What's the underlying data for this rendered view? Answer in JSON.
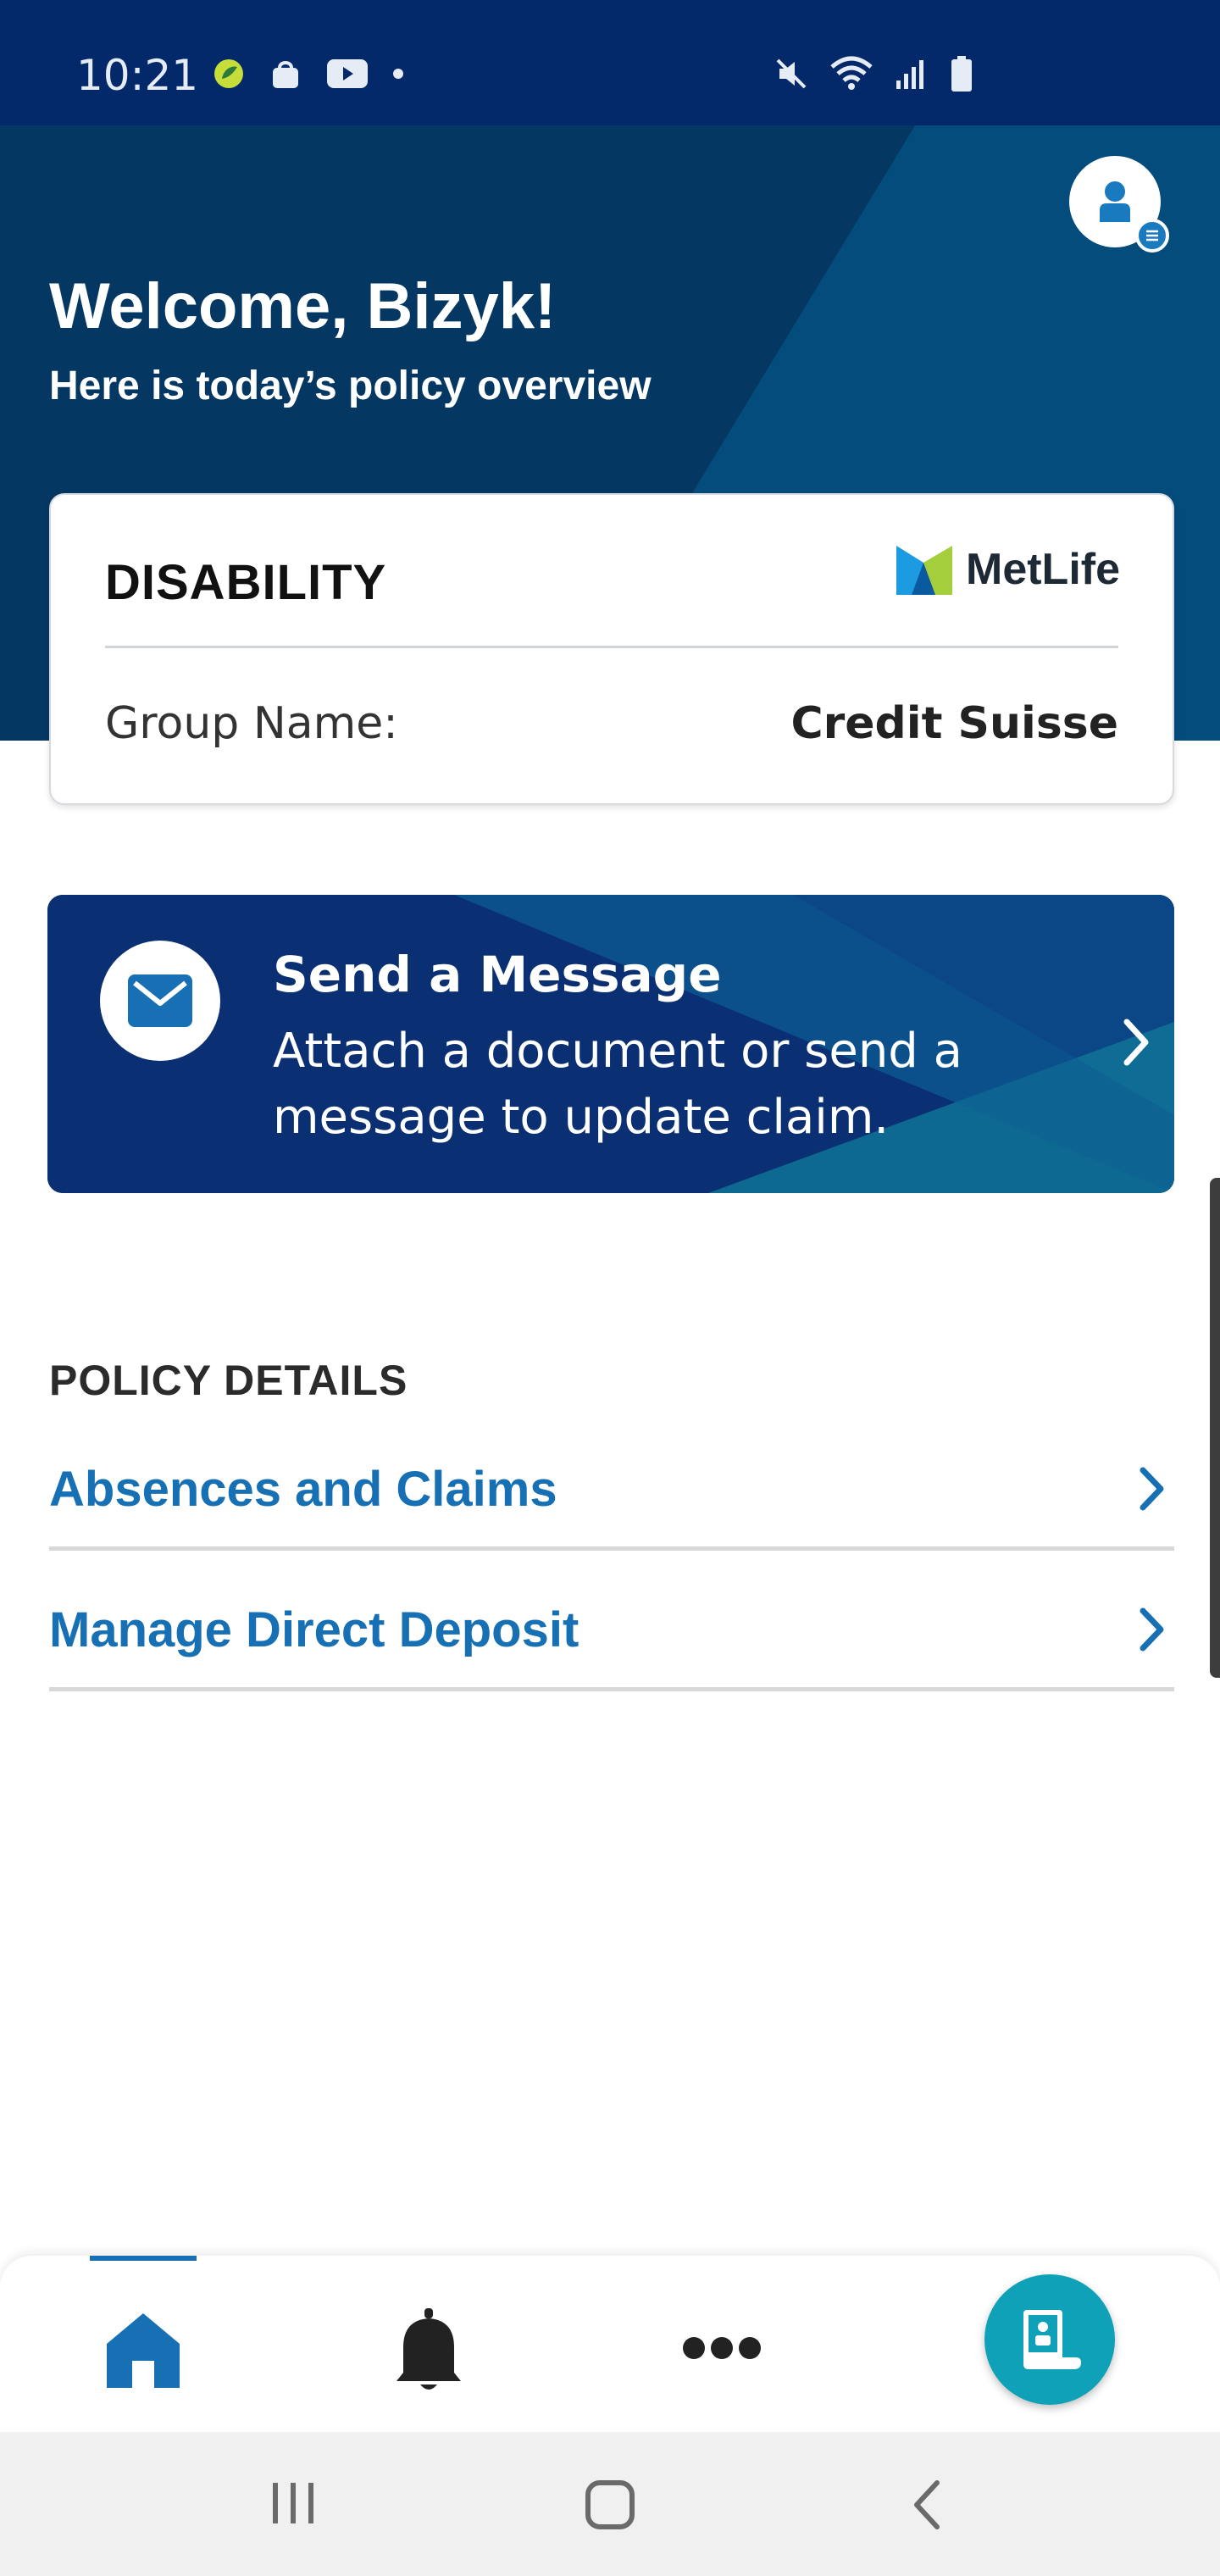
{
  "status_bar": {
    "time": "10:21",
    "left_icons": [
      "app-leaf-icon",
      "shopping-bag-icon",
      "youtube-icon",
      "dot-icon"
    ],
    "right_icons": [
      "mute-icon",
      "wifi-icon",
      "signal-icon",
      "battery-icon"
    ]
  },
  "hero": {
    "welcome": "Welcome, Bizyk!",
    "subtitle": "Here is today’s policy overview"
  },
  "policy_card": {
    "type": "DISABILITY",
    "brand": "MetLife",
    "group_label": "Group Name:",
    "group_value": "Credit Suisse"
  },
  "message_banner": {
    "title": "Send a Message",
    "body": "Attach a document or send a message to update claim."
  },
  "policy_details": {
    "title": "POLICY DETAILS",
    "items": [
      {
        "label": "Absences and Claims"
      },
      {
        "label": "Manage Direct Deposit"
      }
    ]
  },
  "bottom_nav": {
    "items": [
      "home-icon",
      "bell-icon",
      "more-icon",
      "policy-document-icon"
    ],
    "active": "home-icon"
  },
  "colors": {
    "header_navy": "#04296b",
    "hero_blue": "#053d6c",
    "link_blue": "#1670b3",
    "fab_teal": "#0fa1b8"
  }
}
